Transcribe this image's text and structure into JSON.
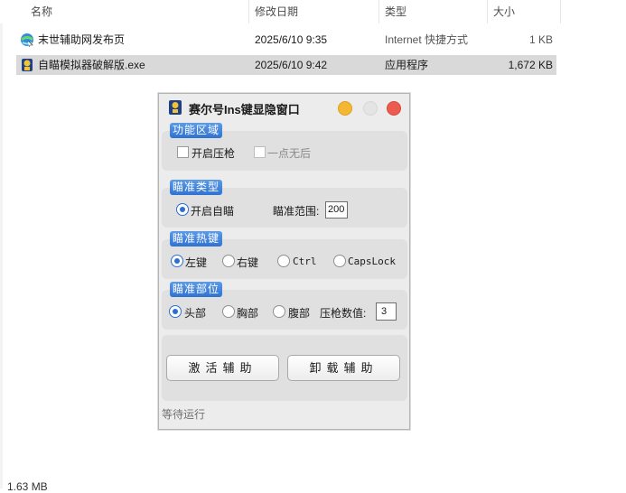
{
  "explorer": {
    "columns": {
      "name": "名称",
      "modified": "修改日期",
      "type": "类型",
      "size": "大小"
    },
    "files": [
      {
        "name": "末世辅助网发布页",
        "modified": "2025/6/10 9:35",
        "type": "Internet 快捷方式",
        "size": "1 KB",
        "icon": "internet-shortcut-icon"
      },
      {
        "name": "自瞄模拟器破解版.exe",
        "modified": "2025/6/10 9:42",
        "type": "应用程序",
        "size": "1,672 KB",
        "icon": "app-exe-icon"
      }
    ],
    "bottom_text": "1.63 MB"
  },
  "dialog": {
    "title": "赛尔号Ins键显隐窗口",
    "groups": {
      "function": {
        "label": "功能区域",
        "options": [
          {
            "label": "开启压枪",
            "checked": false,
            "enabled": true
          },
          {
            "label": "一点无后",
            "checked": false,
            "enabled": false
          }
        ]
      },
      "aim_type": {
        "label": "瞄准类型",
        "option": "开启自瞄",
        "range_label": "瞄准范围:",
        "range_value": "200"
      },
      "aim_hotkey": {
        "label": "瞄准热键",
        "options": [
          "左键",
          "右键",
          "Ctrl",
          "CapsLock"
        ],
        "selected": "左键"
      },
      "aim_part": {
        "label": "瞄准部位",
        "options": [
          "头部",
          "胸部",
          "腹部"
        ],
        "selected": "头部",
        "recoil_label": "压枪数值:",
        "recoil_value": "3"
      }
    },
    "buttons": {
      "activate": "激活辅助",
      "unload": "卸载辅助"
    },
    "status": "等待运行"
  },
  "colors": {
    "accent": "#2f73d2",
    "minimize": "#f5b631",
    "close": "#ec5b50",
    "selected_row": "#d9d9d9"
  }
}
